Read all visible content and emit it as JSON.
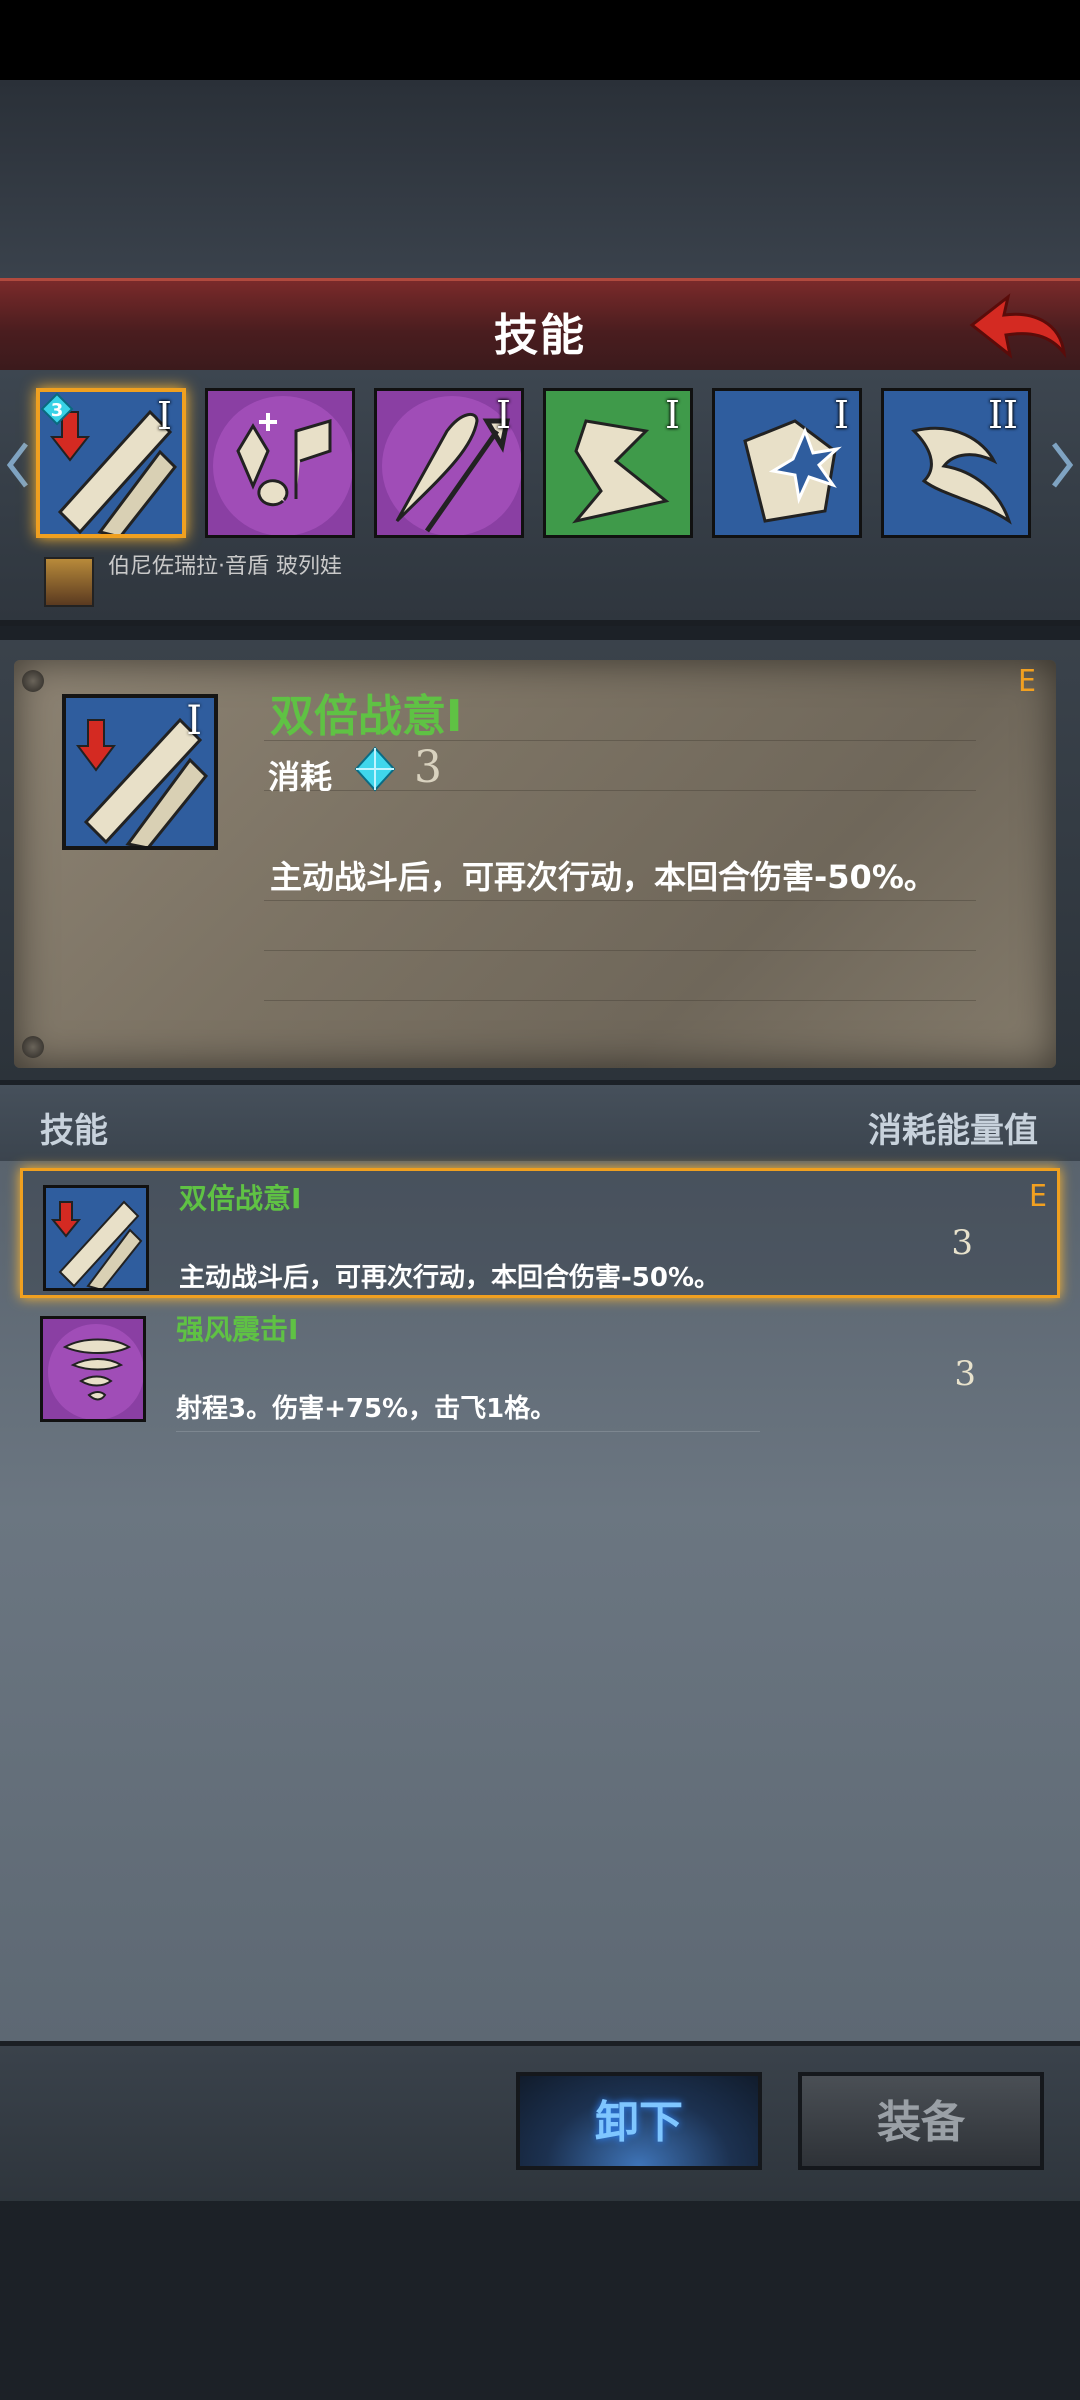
{
  "header": {
    "title": "技能"
  },
  "skill_bar": {
    "icons": [
      {
        "name": "双倍战意",
        "rank": "I",
        "cost_badge": "3",
        "bg": "#2f5d9e"
      },
      {
        "name": "skill-2",
        "rank": "",
        "bg": "#8a3fa3"
      },
      {
        "name": "skill-3",
        "rank": "I",
        "bg": "#8a3fa3"
      },
      {
        "name": "skill-4",
        "rank": "I",
        "bg": "#3f9a4a"
      },
      {
        "name": "skill-5",
        "rank": "I",
        "bg": "#2f5d9e"
      },
      {
        "name": "skill-6",
        "rank": "II",
        "bg": "#2f5d9e"
      }
    ],
    "hero_name": "伯尼佐瑞拉·音盾 玻列娃"
  },
  "detail": {
    "name": "双倍战意I",
    "cost_label": "消耗",
    "cost_value": "3",
    "description": "主动战斗后，可再次行动，本回合伤害-50%。",
    "grade": "E"
  },
  "list": {
    "header_left": "技能",
    "header_right": "消耗能量值",
    "rows": [
      {
        "name": "双倍战意I",
        "description": "主动战斗后，可再次行动，本回合伤害-50%。",
        "cost": "3",
        "grade": "E"
      },
      {
        "name": "强风震击I",
        "description": "射程3。伤害+75%，击飞1格。",
        "cost": "3"
      }
    ]
  },
  "buttons": {
    "unequip": "卸下",
    "equip": "装备"
  },
  "colors": {
    "skill_name": "#5fc244",
    "grade": "#f2a020",
    "accent": "#f0a020"
  }
}
